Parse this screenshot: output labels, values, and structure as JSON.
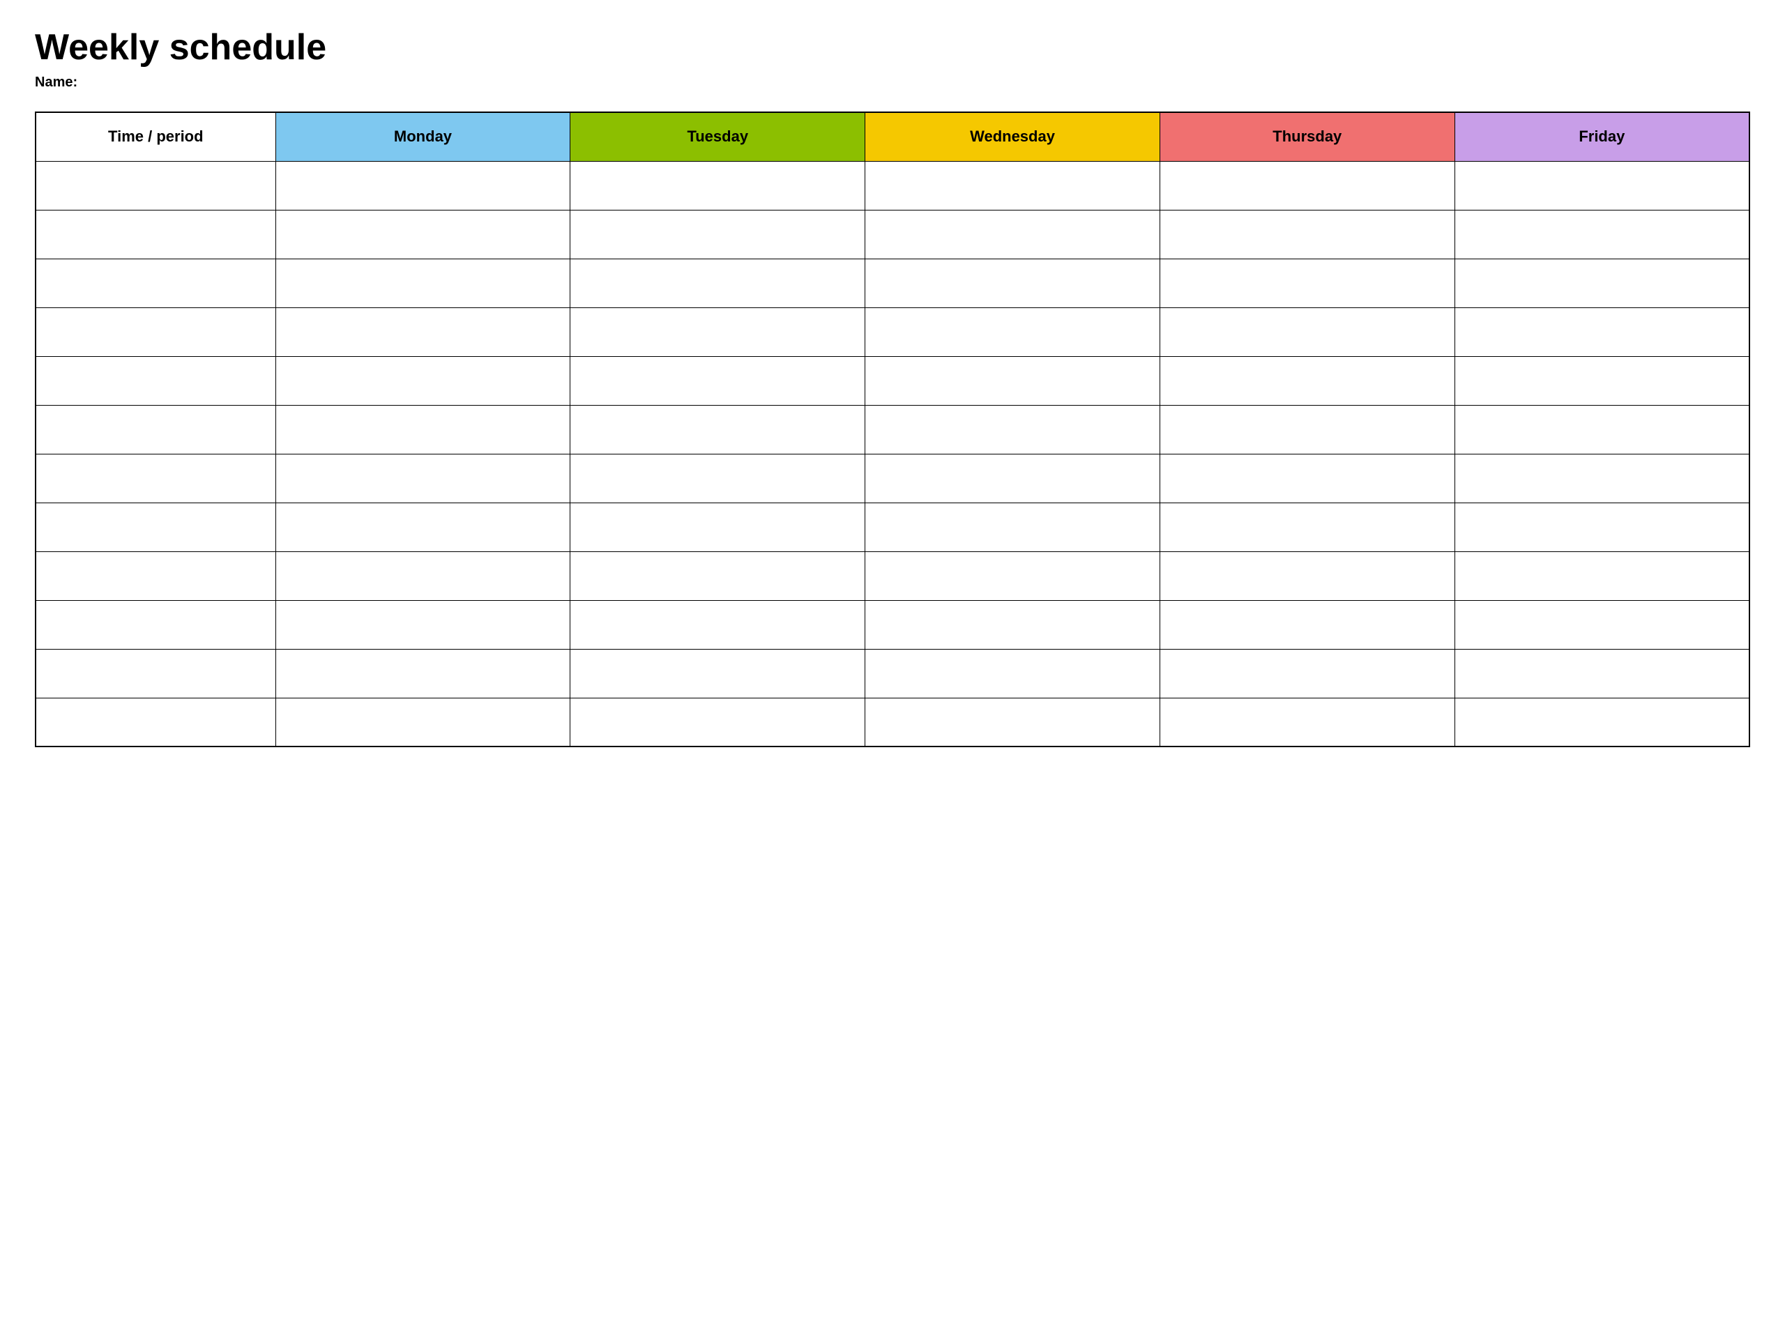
{
  "header": {
    "title": "Weekly schedule",
    "name_label": "Name:"
  },
  "table": {
    "columns": [
      {
        "key": "time",
        "label": "Time / period",
        "color": "#ffffff"
      },
      {
        "key": "monday",
        "label": "Monday",
        "color": "#7EC8F0"
      },
      {
        "key": "tuesday",
        "label": "Tuesday",
        "color": "#8CBF00"
      },
      {
        "key": "wednesday",
        "label": "Wednesday",
        "color": "#F5C800"
      },
      {
        "key": "thursday",
        "label": "Thursday",
        "color": "#F07070"
      },
      {
        "key": "friday",
        "label": "Friday",
        "color": "#C89EE8"
      }
    ],
    "rows": 12
  }
}
